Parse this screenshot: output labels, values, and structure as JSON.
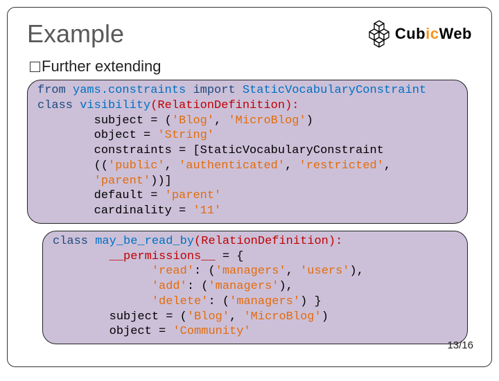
{
  "title": "Example",
  "logo": {
    "text_a": "Cub",
    "text_accent": "ic",
    "text_b": "Web"
  },
  "subtitle": "Further extending",
  "code1": {
    "l1a": "from",
    "l1b": " yams.constraints ",
    "l1c": "import",
    "l1d": " StaticVocabularyConstraint",
    "l2a": "class",
    "l2b": " visibility",
    "l2c": "(RelationDefinition):",
    "l3a": "        subject = (",
    "l3b": "'Blog'",
    "l3c": ", ",
    "l3d": "'MicroBlog'",
    "l3e": ")",
    "l4a": "        object = ",
    "l4b": "'String'",
    "l5": "        constraints = [StaticVocabularyConstraint",
    "l6a": "        ((",
    "l6b": "'public'",
    "l6c": ", ",
    "l6d": "'authenticated'",
    "l6e": ", ",
    "l6f": "'restricted'",
    "l6g": ",",
    "l7a": "        ",
    "l7b": "'parent'",
    "l7c": "))]",
    "l8a": "        default = ",
    "l8b": "'parent'",
    "l9a": "        cardinality = ",
    "l9b": "'11'"
  },
  "code2": {
    "l1a": "class",
    "l1b": " may_be_read_by",
    "l1c": "(RelationDefinition):",
    "l2a": "        ",
    "l2b": "__permissions__",
    "l2c": " = {",
    "l3a": "              ",
    "l3b": "'read'",
    "l3c": ": (",
    "l3d": "'managers'",
    "l3e": ", ",
    "l3f": "'users'",
    "l3g": "),",
    "l4a": "              ",
    "l4b": "'add'",
    "l4c": ": (",
    "l4d": "'managers'",
    "l4e": "),",
    "l5a": "              ",
    "l5b": "'delete'",
    "l5c": ": (",
    "l5d": "'managers'",
    "l5e": ") }",
    "l6a": "        subject = (",
    "l6b": "'Blog'",
    "l6c": ", ",
    "l6d": "'MicroBlog'",
    "l6e": ")",
    "l7a": "        object = ",
    "l7b": "'Community'"
  },
  "pager": "13/16"
}
